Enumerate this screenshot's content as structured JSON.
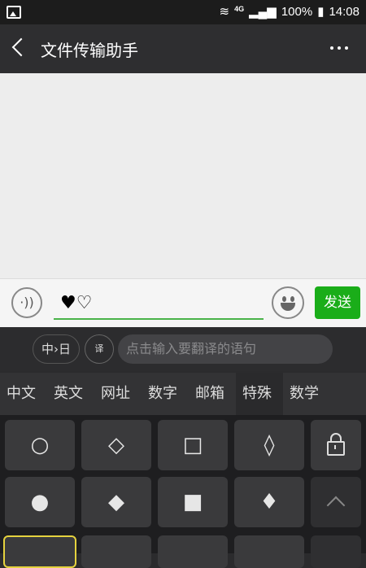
{
  "status_bar": {
    "network": "4G",
    "battery": "100%",
    "time": "14:08"
  },
  "header": {
    "title": "文件传输助手",
    "more_label": "..."
  },
  "composer": {
    "text": "♥♡",
    "send_label": "发送"
  },
  "translate": {
    "lang_label": "中›日",
    "icon_label": "译",
    "placeholder": "点击输入要翻译的语句"
  },
  "tabs": [
    {
      "label": "中文"
    },
    {
      "label": "英文"
    },
    {
      "label": "网址"
    },
    {
      "label": "数字"
    },
    {
      "label": "邮箱"
    },
    {
      "label": "特殊",
      "active": true
    },
    {
      "label": "数学"
    }
  ],
  "keys": {
    "row1": [
      "○",
      "◇",
      "□",
      "◊"
    ],
    "row2": [
      "●",
      "◆",
      "■",
      "♦"
    ]
  },
  "icons": {
    "voice": "voice-icon",
    "emoji": "emoji-icon",
    "lock": "lock-icon",
    "collapse": "chevron-up-icon"
  },
  "colors": {
    "send_button": "#1aad19",
    "input_underline": "#4ab34a",
    "selected_key_border": "#e5d23e"
  }
}
